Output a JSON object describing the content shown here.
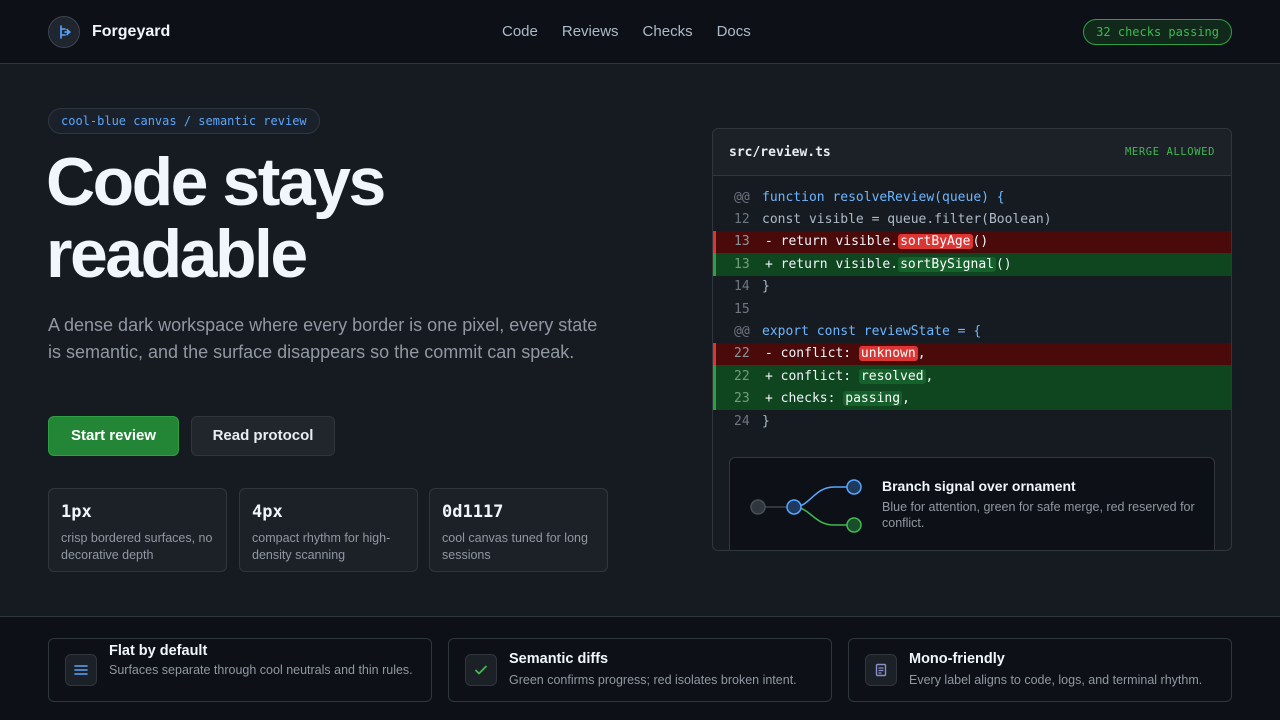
{
  "header": {
    "brand": "Forgeyard",
    "nav": [
      "Code",
      "Reviews",
      "Checks",
      "Docs"
    ],
    "status": "32 checks passing"
  },
  "hero": {
    "tag": "cool-blue canvas / semantic review",
    "headline_line1": "Code stays",
    "headline_line2": "readable",
    "lede": "A dense dark workspace where every border is one pixel, every state is semantic, and the surface disappears so the commit can speak.",
    "primary_cta": "Start review",
    "secondary_cta": "Read protocol",
    "stats": [
      {
        "value": "1px",
        "desc": "crisp bordered surfaces, no decorative depth"
      },
      {
        "value": "4px",
        "desc": "compact rhythm for high-density scanning"
      },
      {
        "value": "0d1117",
        "desc": "cool canvas tuned for long sessions"
      }
    ]
  },
  "diff": {
    "file": "src/review.ts",
    "flag": "MERGE ALLOWED",
    "lines": [
      {
        "kind": "hunk",
        "num": "@@",
        "pre": "function resolveReview(queue) {",
        "tok": "",
        "post": ""
      },
      {
        "kind": "ctx",
        "num": "12",
        "pre": "const visible = queue.filter(Boolean)",
        "tok": "",
        "post": ""
      },
      {
        "kind": "del",
        "num": "13",
        "pre": "- return visible.",
        "tok": "sortByAge",
        "post": "()"
      },
      {
        "kind": "add",
        "num": "13",
        "pre": "+ return visible.",
        "tok": "sortBySignal",
        "post": "()"
      },
      {
        "kind": "ctx",
        "num": "14",
        "pre": "}",
        "tok": "",
        "post": ""
      },
      {
        "kind": "ctx",
        "num": "15",
        "pre": "",
        "tok": "",
        "post": ""
      },
      {
        "kind": "hunk",
        "num": "@@",
        "pre": "export const reviewState = {",
        "tok": "",
        "post": ""
      },
      {
        "kind": "del",
        "num": "22",
        "pre": "- conflict: ",
        "tok": "unknown",
        "post": ","
      },
      {
        "kind": "add",
        "num": "22",
        "pre": "+ conflict: ",
        "tok": "resolved",
        "post": ","
      },
      {
        "kind": "add",
        "num": "23",
        "pre": "+ checks: ",
        "tok": "passing",
        "post": ","
      },
      {
        "kind": "ctx",
        "num": "24",
        "pre": "}",
        "tok": "",
        "post": ""
      }
    ],
    "branch_title": "Branch signal over ornament",
    "branch_desc": "Blue for attention, green for safe merge, red reserved for conflict."
  },
  "features": [
    {
      "icon": "list-icon",
      "title": "Flat by default",
      "desc": "Surfaces separate through cool neutrals and thin rules."
    },
    {
      "icon": "check-icon",
      "title": "Semantic diffs",
      "desc": "Green confirms progress; red isolates broken intent."
    },
    {
      "icon": "document-icon",
      "title": "Mono-friendly",
      "desc": "Every label aligns to code, logs, and terminal rhythm."
    }
  ],
  "colors": {
    "canvas": "#0d1117",
    "accent_blue": "#58a6ff",
    "success_green": "#2ea043",
    "danger_red": "#da3633"
  }
}
